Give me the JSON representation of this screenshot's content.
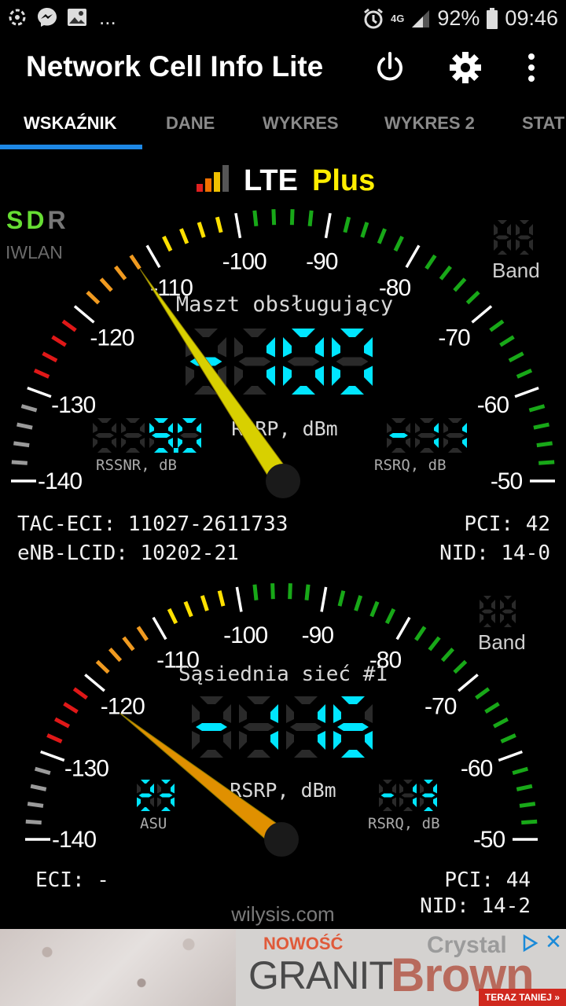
{
  "status_bar": {
    "overflow": "...",
    "network": "4G",
    "battery": "92%",
    "time": "09:46"
  },
  "app_bar": {
    "title": "Network Cell Info Lite",
    "icons": [
      "power-icon",
      "gear-icon",
      "more-vert-icon"
    ]
  },
  "tabs": [
    {
      "label": "WSKAŹNIK",
      "active": true
    },
    {
      "label": "DANE",
      "active": false
    },
    {
      "label": "WYKRES",
      "active": false
    },
    {
      "label": "WYKRES 2",
      "active": false
    },
    {
      "label": "STAT",
      "active": false
    }
  ],
  "tech": {
    "lte": "LTE",
    "plus": "Plus"
  },
  "sdr": {
    "s": "S",
    "d": "D",
    "r": "R",
    "iwlan": "IWLAN"
  },
  "serving": {
    "title": "Maszt obsługujący",
    "rsrp_value": "-100",
    "rsrp_unit": "RSRP, dBm",
    "rssnr_value": "9.0",
    "rssnr_label": "RSSNR, dB",
    "rsrq_value": "-11",
    "rsrq_label": "RSRQ, dB",
    "band_label": "Band",
    "needle_dbm": -112,
    "scale": [
      "-140",
      "-130",
      "-120",
      "-110",
      "-100",
      "-90",
      "-80",
      "-70",
      "-60",
      "-50"
    ],
    "tac_eci": "TAC-ECI: 11027-2611733",
    "enb_lcid": "eNB-LCID: 10202-21",
    "pci": "PCI: 42",
    "nid": "NID: 14-0"
  },
  "neighbor": {
    "title": "Sąsiednia sieć #1",
    "rsrp_value": "-116",
    "rsrp_unit": "RSRP, dBm",
    "asu_value": "23",
    "asu_label": "ASU",
    "rsrq_value": "-13",
    "rsrq_label": "RSRQ, dB",
    "band_label": "Band",
    "needle_dbm": -121,
    "scale": [
      "-140",
      "-130",
      "-120",
      "-110",
      "-100",
      "-90",
      "-80",
      "-70",
      "-60",
      "-50"
    ],
    "eci": "ECI: -",
    "pci": "PCI: 44",
    "nid": "NID: 14-2"
  },
  "footer": {
    "site": "wilysis.com"
  },
  "ad": {
    "new": "NOWOŚĆ",
    "granit": "GRANIT",
    "crystal": "Crystal",
    "brown": "Brown",
    "cta": "TERAZ TANIEJ »"
  },
  "colors": {
    "accent": "#1e88e5",
    "segment_on": "#00e5ff",
    "segment_off": "#2a2a2a",
    "needle_serving": "#d8d000",
    "needle_neighbor": "#e09000",
    "plus": "#ffee00"
  }
}
